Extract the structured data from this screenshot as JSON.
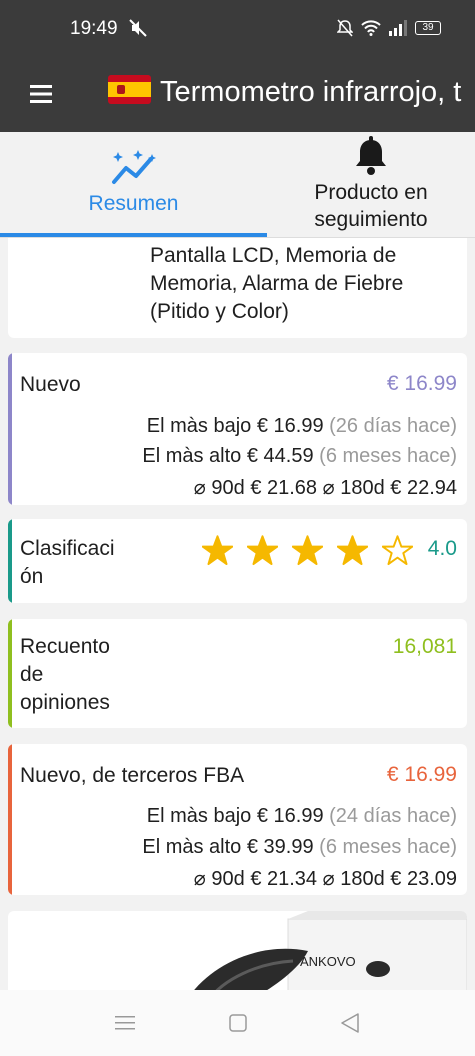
{
  "status_bar": {
    "time": "19:49",
    "battery": "39"
  },
  "app_bar": {
    "title": "Termometro infrarrojo, t"
  },
  "tabs": [
    {
      "label": "Resumen",
      "active": true
    },
    {
      "label": "Producto en seguimiento",
      "active": false
    }
  ],
  "description": {
    "text": "Pantalla LCD, Memoria de Memoria, Alarma de Fiebre (Pitido y Color)"
  },
  "new_card": {
    "title": "Nuevo",
    "price": "€ 16.99",
    "accent_color": "#8d86c9",
    "lowest_label": "El màs bajo",
    "lowest_price": "€ 16.99",
    "lowest_when": "(26 días hace)",
    "highest_label": "El màs alto",
    "highest_price": "€ 44.59",
    "highest_when": "(6 meses hace)",
    "avg90_label": "⌀ 90d",
    "avg90_value": "€ 21.68",
    "avg180_label": "⌀ 180d",
    "avg180_value": "€ 22.94"
  },
  "rating_card": {
    "title": "Clasificación",
    "title_line1": "Clasificaci",
    "title_line2": "ón",
    "rating": 4.0,
    "rating_display": "4.0",
    "accent_color": "#1a9a8a"
  },
  "reviews_card": {
    "title": "Recuento de opiniones",
    "title_lines": [
      "Recuento",
      "de",
      "opiniones"
    ],
    "count": "16,081",
    "accent_color": "#8fbf1f"
  },
  "fba_card": {
    "title": "Nuevo, de terceros FBA",
    "price": "€ 16.99",
    "accent_color": "#e8643c",
    "lowest_label": "El màs bajo",
    "lowest_price": "€ 16.99",
    "lowest_when": "(24 días hace)",
    "highest_label": "El màs alto",
    "highest_price": "€ 39.99",
    "highest_when": "(6 meses hace)",
    "avg90_label": "⌀ 90d",
    "avg90_value": "€ 21.34",
    "avg180_label": "⌀ 180d",
    "avg180_value": "€ 23.09"
  },
  "product_image": {
    "brand_on_box": "ANKOVO"
  },
  "colors": {
    "bar_background": "#3b3b3b",
    "active_tab": "#2b8ae6",
    "star": "#f5b800"
  }
}
